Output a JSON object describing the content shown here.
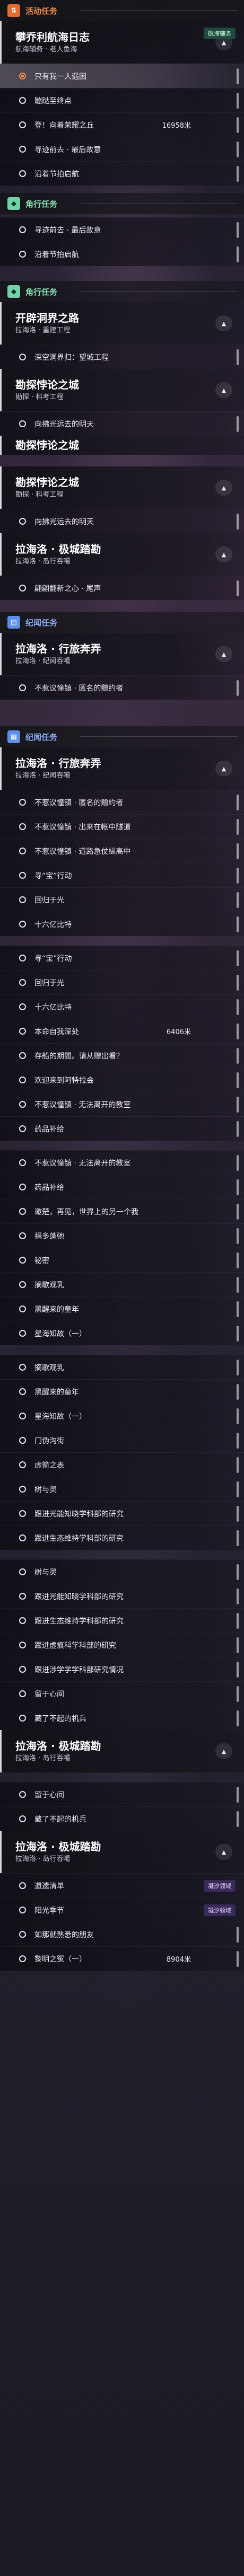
{
  "rows": [
    {
      "t": "section",
      "c": "orange",
      "h": 40,
      "icon": "cycle-icon",
      "text": "活动任务"
    },
    {
      "t": "header",
      "h": 80,
      "title": "攀乔利航海日志",
      "sub": "航海辅务 · 老人鱼海",
      "btn": "▲",
      "tag": "航海辅务"
    },
    {
      "t": "item",
      "h": 46,
      "text": "只有我一人遇困",
      "active": true
    },
    {
      "t": "item",
      "h": 46,
      "text": "蹦跶至终点"
    },
    {
      "t": "item",
      "h": 46,
      "text": "登！向着荣耀之丘",
      "dist": "16958米"
    },
    {
      "t": "item",
      "h": 46,
      "text": "寻迹前去 · 最后故意"
    },
    {
      "t": "item",
      "h": 46,
      "text": "沿着节拍启航"
    },
    {
      "t": "gap",
      "h": 14
    },
    {
      "t": "section",
      "c": "green",
      "h": 40,
      "icon": "pin-icon",
      "text": "角行任务"
    },
    {
      "t": "gap",
      "h": 6
    },
    {
      "t": "item",
      "h": 46,
      "text": "寻迹前去 · 最后故意"
    },
    {
      "t": "item",
      "h": 46,
      "text": "沿着节拍启航"
    },
    {
      "t": "gap",
      "h": 28
    },
    {
      "t": "section",
      "c": "green",
      "h": 40,
      "icon": "pin-icon",
      "text": "角行任务"
    },
    {
      "t": "header",
      "h": 80,
      "title": "开辟洞界之路",
      "sub": "拉海洛 · 重建工程",
      "btn": "▲"
    },
    {
      "t": "item",
      "h": 46,
      "text": "深空洞界归：望城工程"
    },
    {
      "t": "header",
      "h": 80,
      "title": "勘探悖论之城",
      "sub": "勘探 · 科考工程",
      "btn": "▲"
    },
    {
      "t": "item",
      "h": 46,
      "text": "向拂光远去的明天"
    },
    {
      "t": "header",
      "h": 36,
      "title": "勘探悖论之城",
      "sub": "",
      "btn": ""
    },
    {
      "t": "gap",
      "h": 22
    },
    {
      "t": "header",
      "h": 80,
      "title": "勘探悖论之城",
      "sub": "勘探 · 科考工程",
      "btn": "▲"
    },
    {
      "t": "item",
      "h": 46,
      "text": "向拂光远去的明天"
    },
    {
      "t": "header",
      "h": 80,
      "title": "拉海洛 · 极城踏勘",
      "sub": "拉海洛 · 岛行吞噶",
      "btn": "▲"
    },
    {
      "t": "item",
      "h": 46,
      "text": "翩翩翻新之心 · 尾声"
    },
    {
      "t": "gap",
      "h": 22
    },
    {
      "t": "section",
      "c": "blue",
      "h": 40,
      "icon": "book-icon",
      "text": "纪闻任务"
    },
    {
      "t": "header",
      "h": 80,
      "title": "拉海洛 · 行旅奔弄",
      "sub": "拉海洛 · 纪闻吞噶",
      "btn": "▲"
    },
    {
      "t": "item",
      "h": 46,
      "text": "不惹议憧镇 · 匿名的赠约者"
    },
    {
      "t": "gap",
      "h": 50
    },
    {
      "t": "section",
      "c": "blue",
      "h": 40,
      "icon": "book-icon",
      "text": "纪闻任务"
    },
    {
      "t": "header",
      "h": 80,
      "title": "拉海洛 · 行旅奔弄",
      "sub": "拉海洛 · 纪闻吞噶",
      "btn": "▲"
    },
    {
      "t": "item",
      "h": 46,
      "text": "不惹议憧镇 · 匿名的赠约者"
    },
    {
      "t": "item",
      "h": 46,
      "text": "不惹议憧镇 · 出来在帐中隧道"
    },
    {
      "t": "item",
      "h": 46,
      "text": "不惹议憧镇 · 道路急仗纵高中"
    },
    {
      "t": "item",
      "h": 46,
      "text": "寻“宝”行动"
    },
    {
      "t": "item",
      "h": 46,
      "text": "回归于光"
    },
    {
      "t": "item",
      "h": 46,
      "text": "十六亿比特"
    },
    {
      "t": "gap",
      "h": 18
    },
    {
      "t": "item",
      "h": 46,
      "text": "寻“宝”行动"
    },
    {
      "t": "item",
      "h": 46,
      "text": "回归于光"
    },
    {
      "t": "item",
      "h": 46,
      "text": "十六亿比特"
    },
    {
      "t": "item",
      "h": 46,
      "text": "本命自我深处",
      "dist": "6406米"
    },
    {
      "t": "item",
      "h": 46,
      "text": "存船的期間。请从赠出看？"
    },
    {
      "t": "item",
      "h": 46,
      "text": "欢迎来到阿特拉会"
    },
    {
      "t": "item",
      "h": 46,
      "text": "不惹议憧镇 · 无法离开的教室"
    },
    {
      "t": "item",
      "h": 46,
      "text": "药品补给"
    },
    {
      "t": "gap",
      "h": 18
    },
    {
      "t": "item",
      "h": 46,
      "text": "不惹议憧镇 · 无法离开的教室"
    },
    {
      "t": "item",
      "h": 46,
      "text": "药品补给"
    },
    {
      "t": "item",
      "h": 46,
      "text": "邀楚，再见，世界上的另一个我"
    },
    {
      "t": "item",
      "h": 46,
      "text": "捐多蓬弛"
    },
    {
      "t": "item",
      "h": 46,
      "text": "秘密"
    },
    {
      "t": "item",
      "h": 46,
      "text": "摘歌观乳"
    },
    {
      "t": "item",
      "h": 46,
      "text": "黑醒来的童年"
    },
    {
      "t": "item",
      "h": 46,
      "text": "星海知故（一）"
    },
    {
      "t": "gap",
      "h": 18
    },
    {
      "t": "item",
      "h": 46,
      "text": "摘歌观乳"
    },
    {
      "t": "item",
      "h": 46,
      "text": "黑醒来的童年"
    },
    {
      "t": "item",
      "h": 46,
      "text": "星海知故（一）"
    },
    {
      "t": "item",
      "h": 46,
      "text": "门伪沟街"
    },
    {
      "t": "item",
      "h": 46,
      "text": "虚箭之表"
    },
    {
      "t": "item",
      "h": 46,
      "text": "树与灵"
    },
    {
      "t": "item",
      "h": 46,
      "text": "跟进光能知晓学科部的研究"
    },
    {
      "t": "item",
      "h": 46,
      "text": "跟进生态维持学科部的研究"
    },
    {
      "t": "gap",
      "h": 18
    },
    {
      "t": "item",
      "h": 46,
      "text": "树与灵"
    },
    {
      "t": "item",
      "h": 46,
      "text": "跟进光能知晓学科部的研究"
    },
    {
      "t": "item",
      "h": 46,
      "text": "跟进生态维持学科部的研究"
    },
    {
      "t": "item",
      "h": 46,
      "text": "跟进虚痕科学科部的研究"
    },
    {
      "t": "item",
      "h": 46,
      "text": "跟进涉学学学科部研究情况"
    },
    {
      "t": "item",
      "h": 46,
      "text": "留于心间"
    },
    {
      "t": "item",
      "h": 46,
      "text": "藏了不起的机兵"
    },
    {
      "t": "header",
      "h": 80,
      "title": "拉海洛 · 极城踏勘",
      "sub": "拉海洛 · 岛行吞噶",
      "btn": "▲"
    },
    {
      "t": "gap",
      "h": 18
    },
    {
      "t": "item",
      "h": 46,
      "text": "留于心间"
    },
    {
      "t": "item",
      "h": 46,
      "text": "藏了不起的机兵"
    },
    {
      "t": "header",
      "h": 80,
      "title": "拉海洛 · 极城踏勘",
      "sub": "拉海洛 · 岛行吞噶",
      "btn": "▲"
    },
    {
      "t": "item",
      "h": 46,
      "text": "遗遗清单",
      "tag": "凝汐领域"
    },
    {
      "t": "item",
      "h": 46,
      "text": "阳光季节",
      "tag": "凝汐领域"
    },
    {
      "t": "item",
      "h": 46,
      "text": "如那就熟悉的朋友"
    },
    {
      "t": "item",
      "h": 46,
      "text": "黎明之冤（一）",
      "dist": "8904米"
    }
  ]
}
